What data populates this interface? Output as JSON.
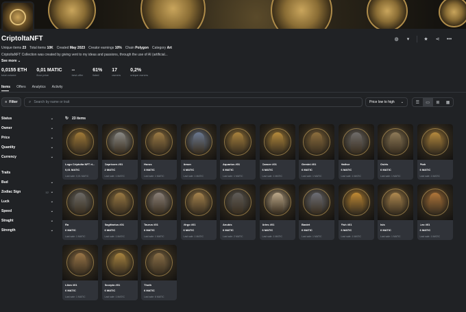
{
  "collection": {
    "name": "CriptoltaNFT",
    "meta": [
      {
        "label": "Unique items",
        "value": "23"
      },
      {
        "label": "Total items",
        "value": "10K"
      },
      {
        "label": "Created",
        "value": "May 2023"
      },
      {
        "label": "Creator earnings",
        "value": "10%"
      },
      {
        "label": "Chain",
        "value": "Polygon"
      },
      {
        "label": "Category",
        "value": "Art"
      }
    ],
    "description": "CriptoltaNFT Collection was created by giving vent to my ideas and passions, through the use of AI (artificial...",
    "see_more": "See more"
  },
  "stats": [
    {
      "value": "0,0155 ETH",
      "label": "total volume"
    },
    {
      "value": "0,01 MATIC",
      "label": "floor price"
    },
    {
      "value": "--",
      "label": "best offer"
    },
    {
      "value": "61%",
      "label": "listed"
    },
    {
      "value": "17",
      "label": "owners"
    },
    {
      "value": "0,2%",
      "label": "unique owners"
    }
  ],
  "tabs": [
    "Items",
    "Offers",
    "Analytics",
    "Activity"
  ],
  "toolbar": {
    "filter_label": "Filter",
    "search_placeholder": "Search by name or trait",
    "sort_label": "Price low to high"
  },
  "sidebar": {
    "groups_top": [
      "Status",
      "Owner",
      "Price",
      "Quantity",
      "Currency"
    ],
    "traits_label": "Traits",
    "traits": [
      {
        "name": "Bud",
        "count": ""
      },
      {
        "name": "Zodiac Sign",
        "count": "12"
      },
      {
        "name": "Luck",
        "count": ""
      },
      {
        "name": "Speed",
        "count": ""
      },
      {
        "name": "Straght",
        "count": ""
      },
      {
        "name": "Strength",
        "count": ""
      }
    ]
  },
  "results_count": "23 items",
  "items": [
    {
      "name": "Logo Criptolta NFT ri...",
      "price": "0,01 MATIC",
      "last": "Last sale: 0,01 MATIC",
      "tone": "#a07a38"
    },
    {
      "name": "Capricorn #01",
      "price": "2 MATIC",
      "last": "Last sale: 1 MATIC",
      "tone": "#8a8a86"
    },
    {
      "name": "Horus",
      "price": "3 MATIC",
      "last": "Last sale: 1 MATIC",
      "tone": "#9c7b45"
    },
    {
      "name": "Amun",
      "price": "6 MATIC",
      "last": "Last sale: 1 MATIC",
      "tone": "#6a7890"
    },
    {
      "name": "Aquarius #01",
      "price": "6 MATIC",
      "last": "Last sale: 1 MATIC",
      "tone": "#a8823e"
    },
    {
      "name": "Cancer #01",
      "price": "6 MATIC",
      "last": "Last sale: 1 MATIC",
      "tone": "#b48a3c"
    },
    {
      "name": "Gemini #01",
      "price": "6 MATIC",
      "last": "Last sale: 1 MATIC",
      "tone": "#8c6e3e"
    },
    {
      "name": "Hathor",
      "price": "6 MATIC",
      "last": "Last sale: 1 MATIC",
      "tone": "#6f6c6a"
    },
    {
      "name": "Osiris",
      "price": "6 MATIC",
      "last": "Last sale: 1 MATIC",
      "tone": "#8e7a58"
    },
    {
      "name": "Ptah",
      "price": "6 MATIC",
      "last": "Last sale: 1 MATIC",
      "tone": "#b5893e"
    },
    {
      "name": "Ra",
      "price": "6 MATIC",
      "last": "Last sale: 1 MATIC",
      "tone": "#6c6a66"
    },
    {
      "name": "Sagittarius #01",
      "price": "6 MATIC",
      "last": "Last sale: 1 MATIC",
      "tone": "#9a7a44"
    },
    {
      "name": "Taurus #01",
      "price": "6 MATIC",
      "last": "Last sale: 1 MATIC",
      "tone": "#8a8078"
    },
    {
      "name": "Virgo #01",
      "price": "6 MATIC",
      "last": "Last sale: 1 MATIC",
      "tone": "#a6844e"
    },
    {
      "name": "Anubis",
      "price": "6 MATIC",
      "last": "Last sale: 2 MATIC",
      "tone": "#5f5c58"
    },
    {
      "name": "Aries #01",
      "price": "6 MATIC",
      "last": "Last sale: 1 MATIC",
      "tone": "#bca88a"
    },
    {
      "name": "Bastet",
      "price": "6 MATIC",
      "last": "Last sale: 1 MATIC",
      "tone": "#6c6e76"
    },
    {
      "name": "Fish #01",
      "price": "6 MATIC",
      "last": "Last sale: 1 MATIC",
      "tone": "#c08a34"
    },
    {
      "name": "Isis",
      "price": "6 MATIC",
      "last": "Last sale: 1 MATIC",
      "tone": "#b08a50"
    },
    {
      "name": "Leo #01",
      "price": "6 MATIC",
      "last": "Last sale: 1 MATIC",
      "tone": "#b0763a"
    },
    {
      "name": "Libra #01",
      "price": "6 MATIC",
      "last": "Last sale: 1 MATIC",
      "tone": "#9a7648"
    },
    {
      "name": "Scorpio #01",
      "price": "6 MATIC",
      "last": "Last sale: 1 MATIC",
      "tone": "#a88440"
    },
    {
      "name": "Thoth",
      "price": "6 MATIC",
      "last": "Last sale: 6 MATIC",
      "tone": "#8a7048"
    }
  ]
}
